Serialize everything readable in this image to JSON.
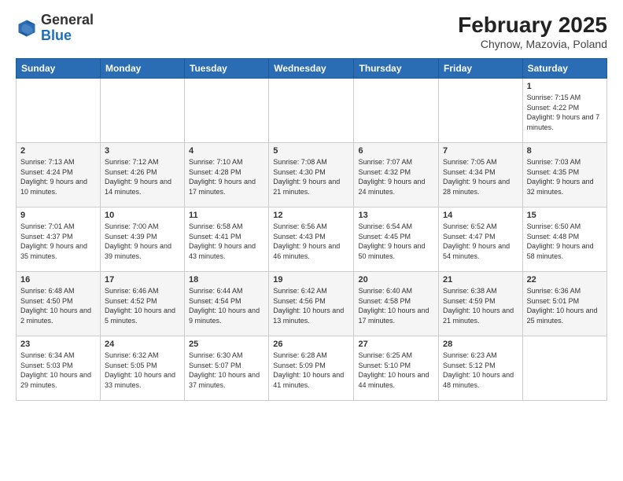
{
  "header": {
    "logo_general": "General",
    "logo_blue": "Blue",
    "month_year": "February 2025",
    "location": "Chynow, Mazovia, Poland"
  },
  "days_of_week": [
    "Sunday",
    "Monday",
    "Tuesday",
    "Wednesday",
    "Thursday",
    "Friday",
    "Saturday"
  ],
  "weeks": [
    [
      {
        "day": "",
        "info": ""
      },
      {
        "day": "",
        "info": ""
      },
      {
        "day": "",
        "info": ""
      },
      {
        "day": "",
        "info": ""
      },
      {
        "day": "",
        "info": ""
      },
      {
        "day": "",
        "info": ""
      },
      {
        "day": "1",
        "info": "Sunrise: 7:15 AM\nSunset: 4:22 PM\nDaylight: 9 hours and 7 minutes."
      }
    ],
    [
      {
        "day": "2",
        "info": "Sunrise: 7:13 AM\nSunset: 4:24 PM\nDaylight: 9 hours and 10 minutes."
      },
      {
        "day": "3",
        "info": "Sunrise: 7:12 AM\nSunset: 4:26 PM\nDaylight: 9 hours and 14 minutes."
      },
      {
        "day": "4",
        "info": "Sunrise: 7:10 AM\nSunset: 4:28 PM\nDaylight: 9 hours and 17 minutes."
      },
      {
        "day": "5",
        "info": "Sunrise: 7:08 AM\nSunset: 4:30 PM\nDaylight: 9 hours and 21 minutes."
      },
      {
        "day": "6",
        "info": "Sunrise: 7:07 AM\nSunset: 4:32 PM\nDaylight: 9 hours and 24 minutes."
      },
      {
        "day": "7",
        "info": "Sunrise: 7:05 AM\nSunset: 4:34 PM\nDaylight: 9 hours and 28 minutes."
      },
      {
        "day": "8",
        "info": "Sunrise: 7:03 AM\nSunset: 4:35 PM\nDaylight: 9 hours and 32 minutes."
      }
    ],
    [
      {
        "day": "9",
        "info": "Sunrise: 7:01 AM\nSunset: 4:37 PM\nDaylight: 9 hours and 35 minutes."
      },
      {
        "day": "10",
        "info": "Sunrise: 7:00 AM\nSunset: 4:39 PM\nDaylight: 9 hours and 39 minutes."
      },
      {
        "day": "11",
        "info": "Sunrise: 6:58 AM\nSunset: 4:41 PM\nDaylight: 9 hours and 43 minutes."
      },
      {
        "day": "12",
        "info": "Sunrise: 6:56 AM\nSunset: 4:43 PM\nDaylight: 9 hours and 46 minutes."
      },
      {
        "day": "13",
        "info": "Sunrise: 6:54 AM\nSunset: 4:45 PM\nDaylight: 9 hours and 50 minutes."
      },
      {
        "day": "14",
        "info": "Sunrise: 6:52 AM\nSunset: 4:47 PM\nDaylight: 9 hours and 54 minutes."
      },
      {
        "day": "15",
        "info": "Sunrise: 6:50 AM\nSunset: 4:48 PM\nDaylight: 9 hours and 58 minutes."
      }
    ],
    [
      {
        "day": "16",
        "info": "Sunrise: 6:48 AM\nSunset: 4:50 PM\nDaylight: 10 hours and 2 minutes."
      },
      {
        "day": "17",
        "info": "Sunrise: 6:46 AM\nSunset: 4:52 PM\nDaylight: 10 hours and 5 minutes."
      },
      {
        "day": "18",
        "info": "Sunrise: 6:44 AM\nSunset: 4:54 PM\nDaylight: 10 hours and 9 minutes."
      },
      {
        "day": "19",
        "info": "Sunrise: 6:42 AM\nSunset: 4:56 PM\nDaylight: 10 hours and 13 minutes."
      },
      {
        "day": "20",
        "info": "Sunrise: 6:40 AM\nSunset: 4:58 PM\nDaylight: 10 hours and 17 minutes."
      },
      {
        "day": "21",
        "info": "Sunrise: 6:38 AM\nSunset: 4:59 PM\nDaylight: 10 hours and 21 minutes."
      },
      {
        "day": "22",
        "info": "Sunrise: 6:36 AM\nSunset: 5:01 PM\nDaylight: 10 hours and 25 minutes."
      }
    ],
    [
      {
        "day": "23",
        "info": "Sunrise: 6:34 AM\nSunset: 5:03 PM\nDaylight: 10 hours and 29 minutes."
      },
      {
        "day": "24",
        "info": "Sunrise: 6:32 AM\nSunset: 5:05 PM\nDaylight: 10 hours and 33 minutes."
      },
      {
        "day": "25",
        "info": "Sunrise: 6:30 AM\nSunset: 5:07 PM\nDaylight: 10 hours and 37 minutes."
      },
      {
        "day": "26",
        "info": "Sunrise: 6:28 AM\nSunset: 5:09 PM\nDaylight: 10 hours and 41 minutes."
      },
      {
        "day": "27",
        "info": "Sunrise: 6:25 AM\nSunset: 5:10 PM\nDaylight: 10 hours and 44 minutes."
      },
      {
        "day": "28",
        "info": "Sunrise: 6:23 AM\nSunset: 5:12 PM\nDaylight: 10 hours and 48 minutes."
      },
      {
        "day": "",
        "info": ""
      }
    ]
  ]
}
